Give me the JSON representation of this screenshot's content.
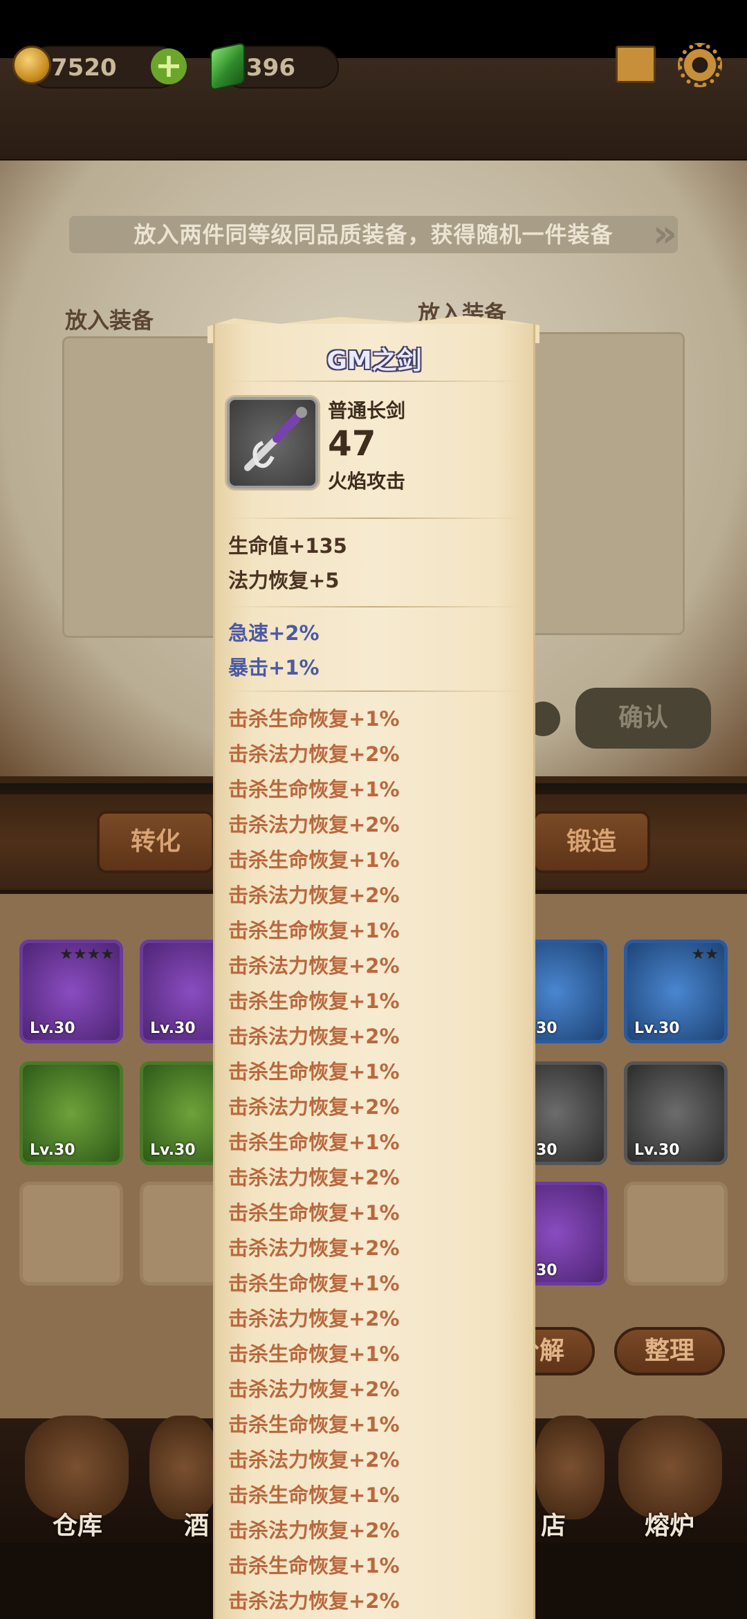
{
  "currency": {
    "gold": "7520",
    "gems": "396"
  },
  "forge": {
    "hint": "放入两件同等级同品质装备，获得随机一件装备",
    "slot_left_label": "放入装备",
    "slot_right_label": "放入装备",
    "confirm_label": "确认"
  },
  "tabs": {
    "convert": "转化",
    "forge": "锻造"
  },
  "inventory": {
    "level_label": "Lv.30",
    "partial_level_label": "30",
    "decompose_label": "分解",
    "sort_label": "整理"
  },
  "nav": {
    "warehouse": "仓库",
    "tavern": "酒",
    "shop": "店",
    "furnace": "熔炉"
  },
  "tooltip": {
    "name": "GM之剑",
    "type": "普通长剑",
    "level": "47",
    "skill": "火焰攻击",
    "base_stats": [
      "生命值+135",
      "法力恢复+5"
    ],
    "blue_stats": [
      "急速+2%",
      "暴击+1%"
    ],
    "red_stats": [
      "击杀生命恢复+1%",
      "击杀法力恢复+2%",
      "击杀生命恢复+1%",
      "击杀法力恢复+2%",
      "击杀生命恢复+1%",
      "击杀法力恢复+2%",
      "击杀生命恢复+1%",
      "击杀法力恢复+2%",
      "击杀生命恢复+1%",
      "击杀法力恢复+2%",
      "击杀生命恢复+1%",
      "击杀法力恢复+2%",
      "击杀生命恢复+1%",
      "击杀法力恢复+2%",
      "击杀生命恢复+1%",
      "击杀法力恢复+2%",
      "击杀生命恢复+1%",
      "击杀法力恢复+2%",
      "击杀生命恢复+1%",
      "击杀法力恢复+2%",
      "击杀生命恢复+1%",
      "击杀法力恢复+2%",
      "击杀生命恢复+1%",
      "击杀法力恢复+2%",
      "击杀生命恢复+1%",
      "击杀法力恢复+2%"
    ]
  },
  "colors": {
    "tooltip_name": "#eaeaff",
    "base_stat": "#4a3322",
    "blue_stat": "#4a5aa6",
    "red_stat": "#b9683e"
  }
}
